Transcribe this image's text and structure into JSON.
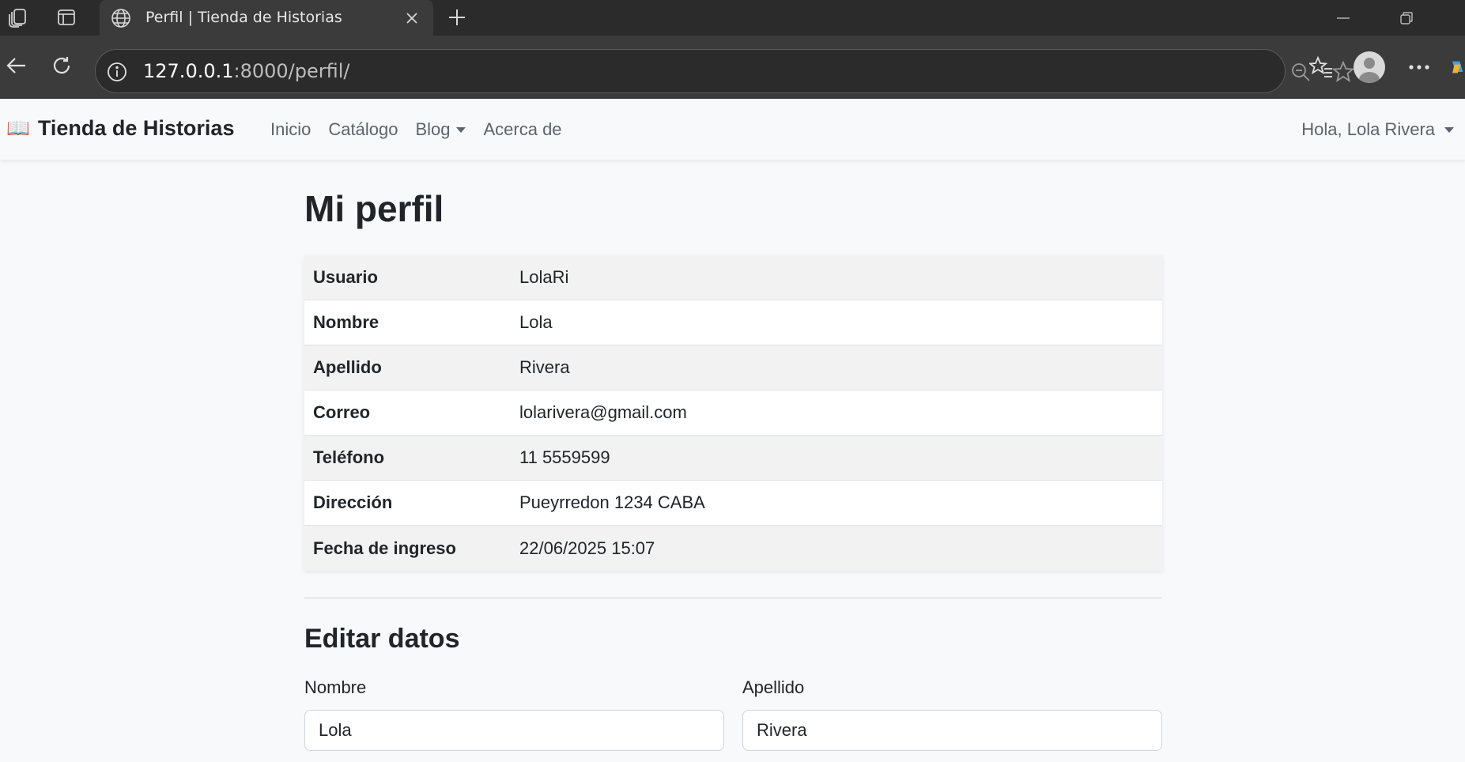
{
  "browser": {
    "tab_title": "Perfil | Tienda de Historias",
    "url_host": "127.0.0.1",
    "url_rest": ":8000/perfil/"
  },
  "navbar": {
    "brand_icon": "📖",
    "brand_name": "Tienda de Historias",
    "links": [
      "Inicio",
      "Catálogo",
      "Blog",
      "Acerca de"
    ],
    "user_greeting": "Hola, Lola Rivera"
  },
  "profile": {
    "title": "Mi perfil",
    "rows": [
      {
        "label": "Usuario",
        "value": "LolaRi"
      },
      {
        "label": "Nombre",
        "value": "Lola"
      },
      {
        "label": "Apellido",
        "value": "Rivera"
      },
      {
        "label": "Correo",
        "value": "lolarivera@gmail.com"
      },
      {
        "label": "Teléfono",
        "value": "11 5559599"
      },
      {
        "label": "Dirección",
        "value": "Pueyrredon 1234 CABA"
      },
      {
        "label": "Fecha de ingreso",
        "value": "22/06/2025 15:07"
      }
    ]
  },
  "edit": {
    "title": "Editar datos",
    "first_name_label": "Nombre",
    "first_name_value": "Lola",
    "last_name_label": "Apellido",
    "last_name_value": "Rivera"
  }
}
